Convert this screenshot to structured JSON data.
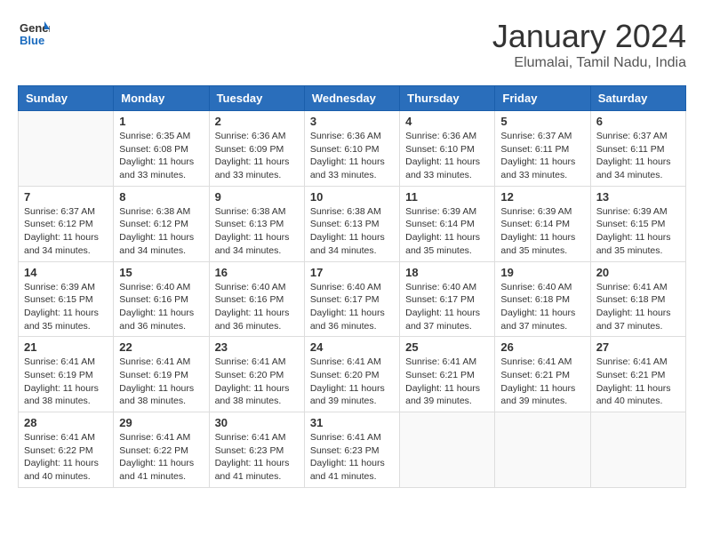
{
  "logo": {
    "line1": "General",
    "line2": "Blue"
  },
  "title": "January 2024",
  "subtitle": "Elumalai, Tamil Nadu, India",
  "weekdays": [
    "Sunday",
    "Monday",
    "Tuesday",
    "Wednesday",
    "Thursday",
    "Friday",
    "Saturday"
  ],
  "weeks": [
    [
      {
        "day": "",
        "detail": ""
      },
      {
        "day": "1",
        "detail": "Sunrise: 6:35 AM\nSunset: 6:08 PM\nDaylight: 11 hours\nand 33 minutes."
      },
      {
        "day": "2",
        "detail": "Sunrise: 6:36 AM\nSunset: 6:09 PM\nDaylight: 11 hours\nand 33 minutes."
      },
      {
        "day": "3",
        "detail": "Sunrise: 6:36 AM\nSunset: 6:10 PM\nDaylight: 11 hours\nand 33 minutes."
      },
      {
        "day": "4",
        "detail": "Sunrise: 6:36 AM\nSunset: 6:10 PM\nDaylight: 11 hours\nand 33 minutes."
      },
      {
        "day": "5",
        "detail": "Sunrise: 6:37 AM\nSunset: 6:11 PM\nDaylight: 11 hours\nand 33 minutes."
      },
      {
        "day": "6",
        "detail": "Sunrise: 6:37 AM\nSunset: 6:11 PM\nDaylight: 11 hours\nand 34 minutes."
      }
    ],
    [
      {
        "day": "7",
        "detail": "Sunrise: 6:37 AM\nSunset: 6:12 PM\nDaylight: 11 hours\nand 34 minutes."
      },
      {
        "day": "8",
        "detail": "Sunrise: 6:38 AM\nSunset: 6:12 PM\nDaylight: 11 hours\nand 34 minutes."
      },
      {
        "day": "9",
        "detail": "Sunrise: 6:38 AM\nSunset: 6:13 PM\nDaylight: 11 hours\nand 34 minutes."
      },
      {
        "day": "10",
        "detail": "Sunrise: 6:38 AM\nSunset: 6:13 PM\nDaylight: 11 hours\nand 34 minutes."
      },
      {
        "day": "11",
        "detail": "Sunrise: 6:39 AM\nSunset: 6:14 PM\nDaylight: 11 hours\nand 35 minutes."
      },
      {
        "day": "12",
        "detail": "Sunrise: 6:39 AM\nSunset: 6:14 PM\nDaylight: 11 hours\nand 35 minutes."
      },
      {
        "day": "13",
        "detail": "Sunrise: 6:39 AM\nSunset: 6:15 PM\nDaylight: 11 hours\nand 35 minutes."
      }
    ],
    [
      {
        "day": "14",
        "detail": "Sunrise: 6:39 AM\nSunset: 6:15 PM\nDaylight: 11 hours\nand 35 minutes."
      },
      {
        "day": "15",
        "detail": "Sunrise: 6:40 AM\nSunset: 6:16 PM\nDaylight: 11 hours\nand 36 minutes."
      },
      {
        "day": "16",
        "detail": "Sunrise: 6:40 AM\nSunset: 6:16 PM\nDaylight: 11 hours\nand 36 minutes."
      },
      {
        "day": "17",
        "detail": "Sunrise: 6:40 AM\nSunset: 6:17 PM\nDaylight: 11 hours\nand 36 minutes."
      },
      {
        "day": "18",
        "detail": "Sunrise: 6:40 AM\nSunset: 6:17 PM\nDaylight: 11 hours\nand 37 minutes."
      },
      {
        "day": "19",
        "detail": "Sunrise: 6:40 AM\nSunset: 6:18 PM\nDaylight: 11 hours\nand 37 minutes."
      },
      {
        "day": "20",
        "detail": "Sunrise: 6:41 AM\nSunset: 6:18 PM\nDaylight: 11 hours\nand 37 minutes."
      }
    ],
    [
      {
        "day": "21",
        "detail": "Sunrise: 6:41 AM\nSunset: 6:19 PM\nDaylight: 11 hours\nand 38 minutes."
      },
      {
        "day": "22",
        "detail": "Sunrise: 6:41 AM\nSunset: 6:19 PM\nDaylight: 11 hours\nand 38 minutes."
      },
      {
        "day": "23",
        "detail": "Sunrise: 6:41 AM\nSunset: 6:20 PM\nDaylight: 11 hours\nand 38 minutes."
      },
      {
        "day": "24",
        "detail": "Sunrise: 6:41 AM\nSunset: 6:20 PM\nDaylight: 11 hours\nand 39 minutes."
      },
      {
        "day": "25",
        "detail": "Sunrise: 6:41 AM\nSunset: 6:21 PM\nDaylight: 11 hours\nand 39 minutes."
      },
      {
        "day": "26",
        "detail": "Sunrise: 6:41 AM\nSunset: 6:21 PM\nDaylight: 11 hours\nand 39 minutes."
      },
      {
        "day": "27",
        "detail": "Sunrise: 6:41 AM\nSunset: 6:21 PM\nDaylight: 11 hours\nand 40 minutes."
      }
    ],
    [
      {
        "day": "28",
        "detail": "Sunrise: 6:41 AM\nSunset: 6:22 PM\nDaylight: 11 hours\nand 40 minutes."
      },
      {
        "day": "29",
        "detail": "Sunrise: 6:41 AM\nSunset: 6:22 PM\nDaylight: 11 hours\nand 41 minutes."
      },
      {
        "day": "30",
        "detail": "Sunrise: 6:41 AM\nSunset: 6:23 PM\nDaylight: 11 hours\nand 41 minutes."
      },
      {
        "day": "31",
        "detail": "Sunrise: 6:41 AM\nSunset: 6:23 PM\nDaylight: 11 hours\nand 41 minutes."
      },
      {
        "day": "",
        "detail": ""
      },
      {
        "day": "",
        "detail": ""
      },
      {
        "day": "",
        "detail": ""
      }
    ]
  ]
}
